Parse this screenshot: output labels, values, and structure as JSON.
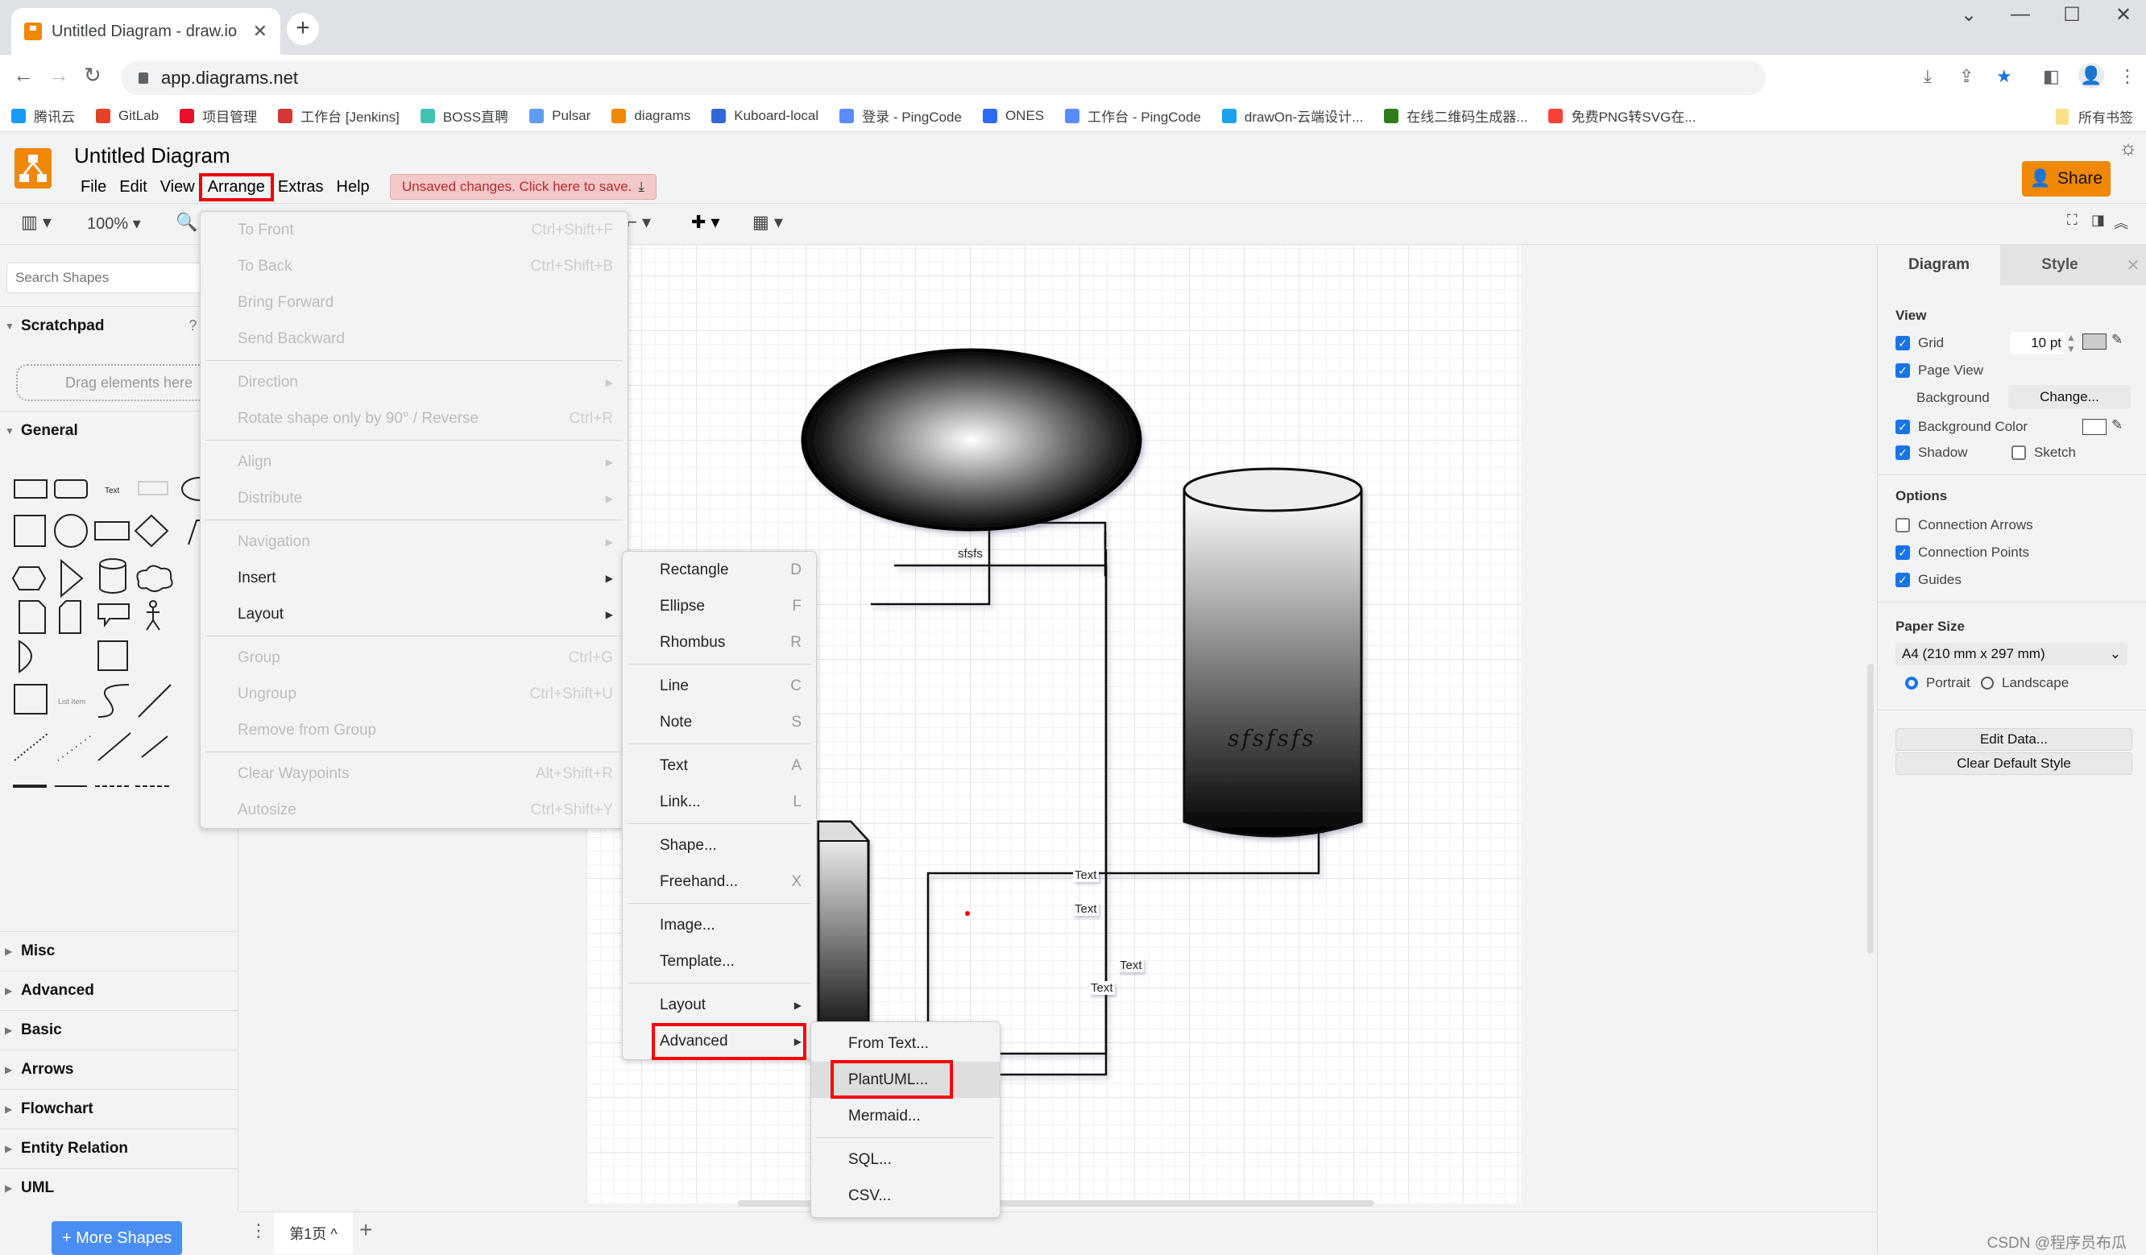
{
  "browser": {
    "tab_title": "Untitled Diagram - draw.io",
    "url": "app.diagrams.net",
    "bookmarks": [
      {
        "label": "腾讯云",
        "color": "#1a9af7"
      },
      {
        "label": "GitLab",
        "color": "#e24329"
      },
      {
        "label": "项目管理",
        "color": "#e8112d"
      },
      {
        "label": "工作台 [Jenkins]",
        "color": "#d33833"
      },
      {
        "label": "BOSS直聘",
        "color": "#44c2b1"
      },
      {
        "label": "Pulsar",
        "color": "#5e9cf0"
      },
      {
        "label": "diagrams",
        "color": "#f08705"
      },
      {
        "label": "Kuboard-local",
        "color": "#3467d6"
      },
      {
        "label": "登录 - PingCode",
        "color": "#5a8cff"
      },
      {
        "label": "ONES",
        "color": "#2d6cf2"
      },
      {
        "label": "工作台 - PingCode",
        "color": "#5a8cff"
      },
      {
        "label": "drawOn-云端设计...",
        "color": "#1ba2e8"
      },
      {
        "label": "在线二维码生成器...",
        "color": "#2e7d1a"
      },
      {
        "label": "免费PNG转SVG在...",
        "color": "#f44336"
      }
    ],
    "all_bookmarks": "所有书签"
  },
  "app": {
    "title": "Untitled Diagram",
    "menus": [
      "File",
      "Edit",
      "View",
      "Arrange",
      "Extras",
      "Help"
    ],
    "active_menu": "Arrange",
    "unsaved": "Unsaved changes. Click here to save.",
    "share": "Share",
    "zoom": "100%"
  },
  "sidebar": {
    "search_placeholder": "Search Shapes",
    "scratchpad": "Scratchpad",
    "scratch_tools": "? +",
    "dropzone": "Drag elements here",
    "general": "General",
    "sections": [
      "Misc",
      "Advanced",
      "Basic",
      "Arrows",
      "Flowchart",
      "Entity Relation",
      "UML"
    ],
    "more_shapes": "+ More Shapes"
  },
  "canvas": {
    "ellipse_label": "sfsfs",
    "cylinder_label": "sfsfsfs",
    "edge_labels": [
      "Text",
      "Text",
      "Text",
      "Text"
    ]
  },
  "pagebar": {
    "page_tab": "第1页 ^"
  },
  "format": {
    "tabs": [
      "Diagram",
      "Style"
    ],
    "view": "View",
    "grid": "Grid",
    "grid_size": "10 pt",
    "page_view": "Page View",
    "background": "Background",
    "change": "Change...",
    "background_color": "Background Color",
    "shadow": "Shadow",
    "sketch": "Sketch",
    "options": "Options",
    "connection_arrows": "Connection Arrows",
    "connection_points": "Connection Points",
    "guides": "Guides",
    "paper_size": "Paper Size",
    "paper_value": "A4 (210 mm x 297 mm)",
    "portrait": "Portrait",
    "landscape": "Landscape",
    "edit_data": "Edit Data...",
    "clear_style": "Clear Default Style"
  },
  "arrange_menu": [
    {
      "label": "To Front",
      "shortcut": "Ctrl+Shift+F",
      "disabled": true
    },
    {
      "label": "To Back",
      "shortcut": "Ctrl+Shift+B",
      "disabled": true
    },
    {
      "label": "Bring Forward",
      "shortcut": "",
      "disabled": true
    },
    {
      "label": "Send Backward",
      "shortcut": "",
      "disabled": true
    },
    {
      "sep": true
    },
    {
      "label": "Direction",
      "submenu": true,
      "disabled": true
    },
    {
      "label": "Rotate shape only by 90° / Reverse",
      "shortcut": "Ctrl+R",
      "disabled": true
    },
    {
      "sep": true
    },
    {
      "label": "Align",
      "submenu": true,
      "disabled": true
    },
    {
      "label": "Distribute",
      "submenu": true,
      "disabled": true
    },
    {
      "sep": true
    },
    {
      "label": "Navigation",
      "submenu": true,
      "disabled": true
    },
    {
      "label": "Insert",
      "submenu": true,
      "disabled": false
    },
    {
      "label": "Layout",
      "submenu": true,
      "disabled": false
    },
    {
      "sep": true
    },
    {
      "label": "Group",
      "shortcut": "Ctrl+G",
      "disabled": true
    },
    {
      "label": "Ungroup",
      "shortcut": "Ctrl+Shift+U",
      "disabled": true
    },
    {
      "label": "Remove from Group",
      "shortcut": "",
      "disabled": true
    },
    {
      "sep": true
    },
    {
      "label": "Clear Waypoints",
      "shortcut": "Alt+Shift+R",
      "disabled": true
    },
    {
      "label": "Autosize",
      "shortcut": "Ctrl+Shift+Y",
      "disabled": true
    }
  ],
  "insert_menu": [
    {
      "label": "Rectangle",
      "shortcut": "D"
    },
    {
      "label": "Ellipse",
      "shortcut": "F"
    },
    {
      "label": "Rhombus",
      "shortcut": "R"
    },
    {
      "sep": true
    },
    {
      "label": "Line",
      "shortcut": "C"
    },
    {
      "label": "Note",
      "shortcut": "S"
    },
    {
      "sep": true
    },
    {
      "label": "Text",
      "shortcut": "A"
    },
    {
      "label": "Link...",
      "shortcut": "L"
    },
    {
      "sep": true
    },
    {
      "label": "Shape...",
      "shortcut": ""
    },
    {
      "label": "Freehand...",
      "shortcut": "X"
    },
    {
      "sep": true
    },
    {
      "label": "Image...",
      "shortcut": ""
    },
    {
      "label": "Template...",
      "shortcut": ""
    },
    {
      "sep": true
    },
    {
      "label": "Layout",
      "submenu": true
    },
    {
      "label": "Advanced",
      "submenu": true,
      "highlighted_box": true
    }
  ],
  "advanced_menu": [
    {
      "label": "From Text..."
    },
    {
      "label": "PlantUML...",
      "hover": true,
      "highlighted_box": true
    },
    {
      "label": "Mermaid..."
    },
    {
      "sep": true
    },
    {
      "label": "SQL..."
    },
    {
      "label": "CSV..."
    }
  ],
  "watermark": "CSDN @程序员布瓜"
}
